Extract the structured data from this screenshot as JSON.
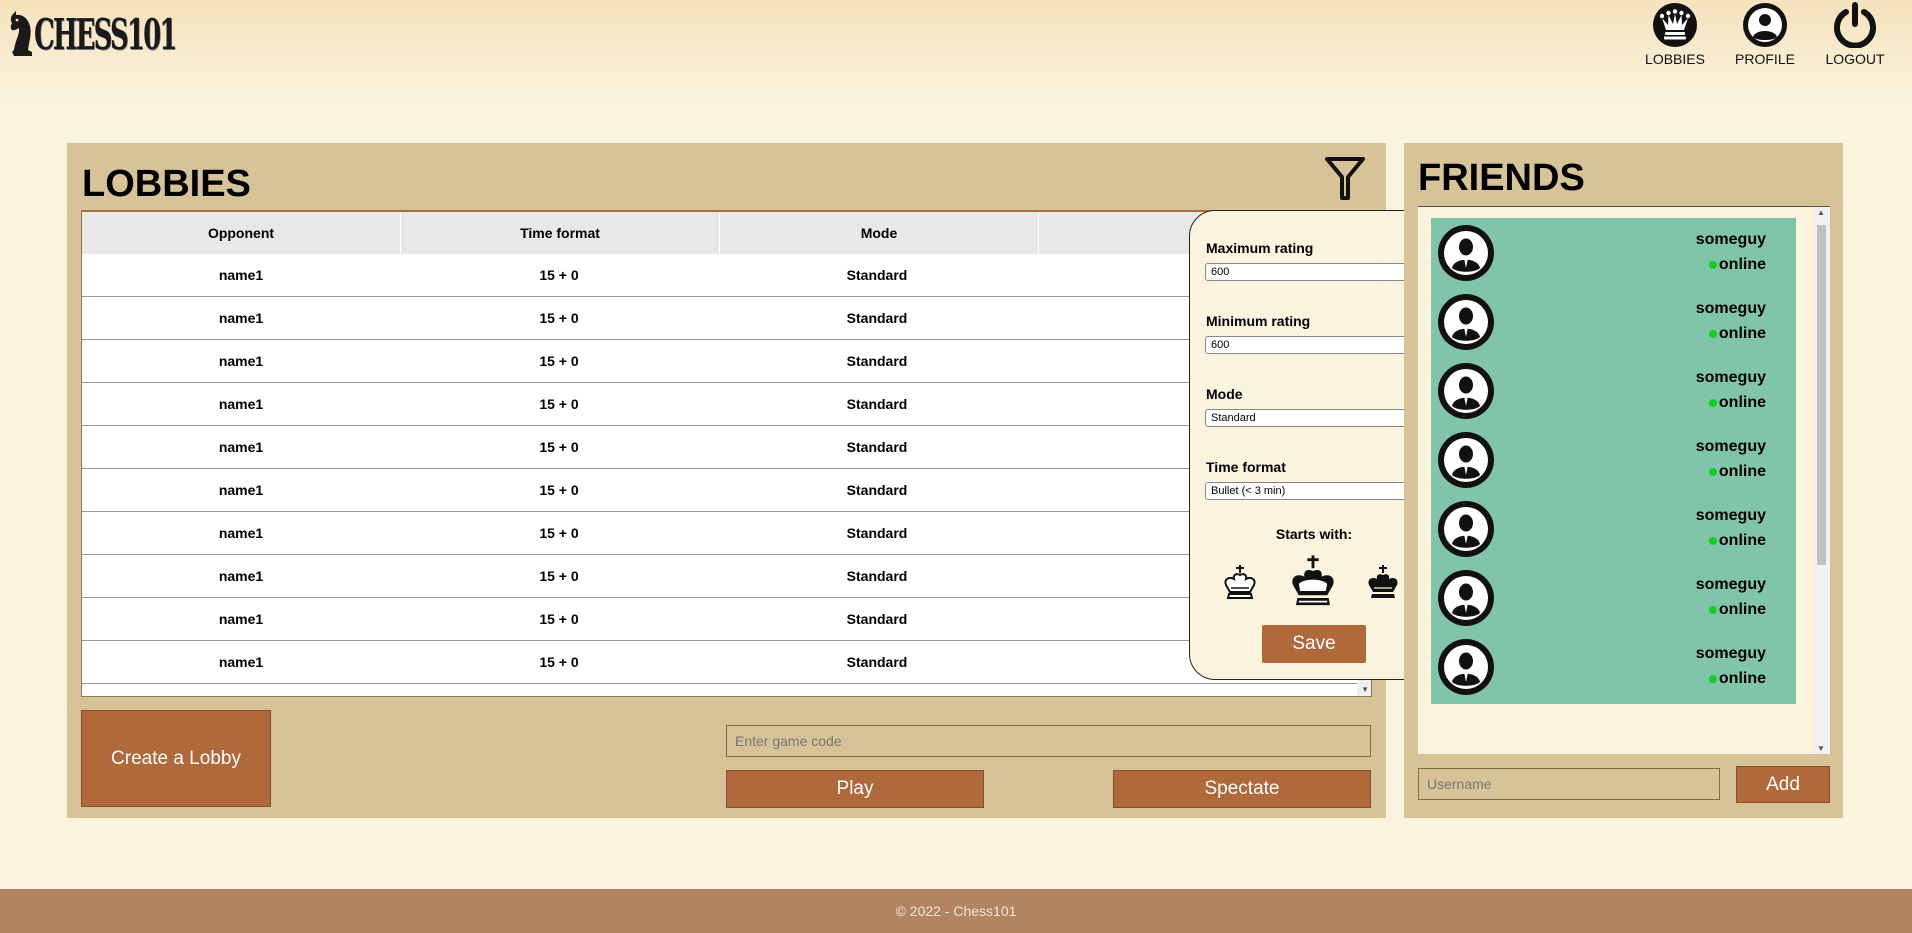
{
  "brand": {
    "logo_text": "CHESS101"
  },
  "nav": [
    {
      "label": "LOBBIES",
      "icon": "queen-icon"
    },
    {
      "label": "PROFILE",
      "icon": "profile-icon"
    },
    {
      "label": "LOGOUT",
      "icon": "power-icon"
    }
  ],
  "lobbies": {
    "title": "LOBBIES",
    "columns": [
      "Opponent",
      "Time format",
      "Mode"
    ],
    "rows": [
      {
        "opponent": "name1",
        "time": "15 + 0",
        "mode": "Standard"
      },
      {
        "opponent": "name1",
        "time": "15 + 0",
        "mode": "Standard"
      },
      {
        "opponent": "name1",
        "time": "15 + 0",
        "mode": "Standard"
      },
      {
        "opponent": "name1",
        "time": "15 + 0",
        "mode": "Standard"
      },
      {
        "opponent": "name1",
        "time": "15 + 0",
        "mode": "Standard"
      },
      {
        "opponent": "name1",
        "time": "15 + 0",
        "mode": "Standard"
      },
      {
        "opponent": "name1",
        "time": "15 + 0",
        "mode": "Standard"
      },
      {
        "opponent": "name1",
        "time": "15 + 0",
        "mode": "Standard"
      },
      {
        "opponent": "name1",
        "time": "15 + 0",
        "mode": "Standard"
      },
      {
        "opponent": "name1",
        "time": "15 + 0",
        "mode": "Standard"
      }
    ],
    "create_label": "Create a Lobby",
    "code_placeholder": "Enter game code",
    "play_label": "Play",
    "spectate_label": "Spectate"
  },
  "filter": {
    "max_rating_label": "Maximum rating",
    "max_rating_value": "600",
    "min_rating_label": "Minimum rating",
    "min_rating_value": "600",
    "mode_label": "Mode",
    "mode_value": "Standard",
    "time_label": "Time format",
    "time_value": "Bullet (< 3 min)",
    "starts_with_label": "Starts with:",
    "save_label": "Save"
  },
  "friends": {
    "title": "FRIENDS",
    "items": [
      {
        "name": "someguy",
        "status": "online"
      },
      {
        "name": "someguy",
        "status": "online"
      },
      {
        "name": "someguy",
        "status": "online"
      },
      {
        "name": "someguy",
        "status": "online"
      },
      {
        "name": "someguy",
        "status": "online"
      },
      {
        "name": "someguy",
        "status": "online"
      },
      {
        "name": "someguy",
        "status": "online"
      }
    ],
    "username_placeholder": "Username",
    "add_label": "Add"
  },
  "footer": {
    "text": "© 2022 - Chess101"
  },
  "colors": {
    "background": "#faf3dd",
    "panel": "#d6c498",
    "button": "#b0693a",
    "friend_card": "#80c4a9",
    "online_dot": "#11d11f",
    "footer": "#b38461"
  }
}
